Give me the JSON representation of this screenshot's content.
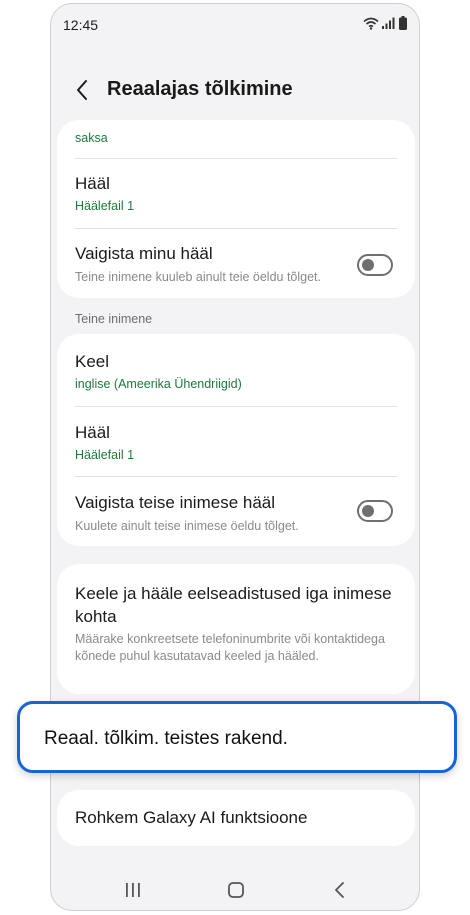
{
  "status": {
    "time": "12:45"
  },
  "header": {
    "title": "Reaalajas tõlkimine"
  },
  "card1": {
    "language_value": "saksa",
    "voice_title": "Hääl",
    "voice_value": "Häälefail 1",
    "mute_title": "Vaigista minu hääl",
    "mute_sub": "Teine inimene kuuleb ainult teie öeldu tõlget."
  },
  "section_other": "Teine inimene",
  "card2": {
    "lang_title": "Keel",
    "lang_value": "inglise (Ameerika Ühendriigid)",
    "voice_title": "Hääl",
    "voice_value": "Häälefail 1",
    "mute_title": "Vaigista teise inimese hääl",
    "mute_sub": "Kuulete ainult teise inimese öeldu tõlget."
  },
  "presets": {
    "title": "Keele ja hääle eelseadistused iga inimese kohta",
    "sub": "Määrake konkreetsete telefoninumbrite või kontaktidega kõnede puhul kasutatavad keeled ja hääled."
  },
  "highlight_label": "Reaal. tõlkim. teistes rakend.",
  "more_ai": "Rohkem Galaxy AI funktsioone",
  "colors": {
    "accent_green": "#1f7a3a",
    "highlight_blue": "#1565d8"
  }
}
